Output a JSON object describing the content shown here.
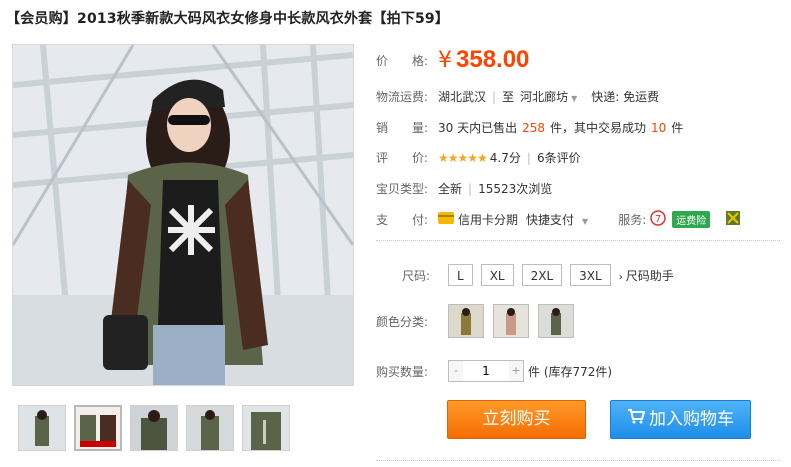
{
  "product": {
    "title": "【会员购】2013秋季新款大码风衣女修身中长款风衣外套【拍下59】"
  },
  "price": {
    "label": "价　　格:",
    "currency": "¥",
    "value": "358.00"
  },
  "shipping": {
    "label": "物流运费:",
    "from": "湖北武汉",
    "to_prefix": "至",
    "to": "河北廊坊",
    "express": "快递: 免运费"
  },
  "sales": {
    "label": "销　　量:",
    "prefix": "30 天内已售出",
    "sold": "258",
    "middle": "件，其中交易成功",
    "success": "10",
    "suffix": "件"
  },
  "rating": {
    "label": "评　　价:",
    "stars": "★★★★★",
    "score": "4.7分",
    "reviews": "6条评价"
  },
  "item_type": {
    "label": "宝贝类型:",
    "condition": "全新",
    "views": "15523次浏览"
  },
  "payment": {
    "label": "支　　付:",
    "credit": "信用卡分期",
    "quick": "快捷支付",
    "service_label": "服务:",
    "service_badge": "运费险"
  },
  "size": {
    "label": "尺码:",
    "options": [
      "L",
      "XL",
      "2XL",
      "3XL"
    ],
    "helper": "尺码助手"
  },
  "color": {
    "label": "颜色分类:"
  },
  "quantity": {
    "label": "购买数量:",
    "minus": "-",
    "value": "1",
    "plus": "+",
    "stock": "件 (库存772件)"
  },
  "actions": {
    "buy_now": "立刻购买",
    "add_cart": "加入购物车"
  },
  "colors": {
    "accent": "#ff4400",
    "buy_button": "#f66d00",
    "cart_button": "#1f8ee8"
  }
}
